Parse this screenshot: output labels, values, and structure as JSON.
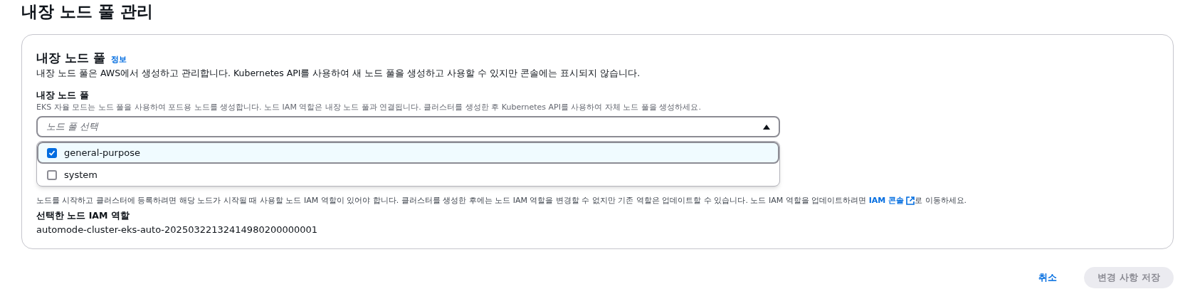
{
  "page_title": "내장 노드 풀 관리",
  "section": {
    "title": "내장 노드 풀",
    "info_link": "정보",
    "description": "내장 노드 풀은 AWS에서 생성하고 관리합니다. Kubernetes API를 사용하여 새 노드 풀을 생성하고 사용할 수 있지만 콘솔에는 표시되지 않습니다."
  },
  "node_pool_field": {
    "label": "내장 노드 풀",
    "hint": "EKS 자율 모드는 노드 풀을 사용하여 포드용 노드를 생성합니다. 노드 IAM 역할은 내장 노드 풀과 연결됩니다. 클러스터를 생성한 후 Kubernetes API를 사용하여 자체 노드 풀을 생성하세요.",
    "placeholder": "노드 풀 선택",
    "expanded": true,
    "options": [
      {
        "label": "general-purpose",
        "checked": true
      },
      {
        "label": "system",
        "checked": false
      }
    ]
  },
  "iam_field": {
    "hint_before": "노드를 시작하고 클러스터에 등록하려면 해당 노드가 시작될 때 사용할 노드 IAM 역할이 있어야 합니다. 클러스터를 생성한 후에는 노드 IAM 역할을 변경할 수 없지만 기존 역할은 업데이트할 수 있습니다. 노드 IAM 역할을 업데이트하려면 ",
    "hint_link": "IAM 콘솔",
    "hint_after": "로 이동하세요.",
    "selected_label": "선택한 노드 IAM 역할",
    "selected_value": "automode-cluster-eks-auto-20250322132414980200000001"
  },
  "buttons": {
    "cancel": "취소",
    "save": "변경 사항 저장",
    "save_disabled": true
  }
}
